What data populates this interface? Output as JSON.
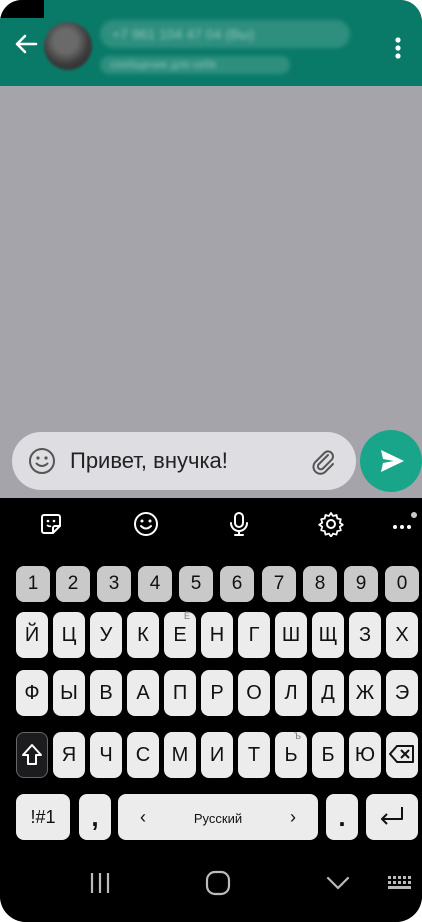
{
  "header": {
    "contact_name": "+7 961 104 47 04 (Вы)",
    "contact_status": "сообщение для себя"
  },
  "composer": {
    "message_text": "Привет, внучка!"
  },
  "keyboard": {
    "number_row": [
      "1",
      "2",
      "3",
      "4",
      "5",
      "6",
      "7",
      "8",
      "9",
      "0"
    ],
    "row1": [
      "Й",
      "Ц",
      "У",
      "К",
      "Е",
      "Н",
      "Г",
      "Ш",
      "Щ",
      "З",
      "Х"
    ],
    "row1_hint": "Ё",
    "row2": [
      "Ф",
      "Ы",
      "В",
      "А",
      "П",
      "Р",
      "О",
      "Л",
      "Д",
      "Ж",
      "Э"
    ],
    "row3": [
      "Я",
      "Ч",
      "С",
      "М",
      "И",
      "Т",
      "Ь",
      "Б",
      "Ю"
    ],
    "row3_hint": "Ъ",
    "symbols_label": "!#1",
    "comma_label": ",",
    "space_left_arrow": "‹",
    "space_label": "Русский",
    "space_right_arrow": "›",
    "period_label": "."
  },
  "colors": {
    "header": "#0a7a68",
    "send_button": "#19a58a",
    "chat_background": "#a4a4aa"
  }
}
